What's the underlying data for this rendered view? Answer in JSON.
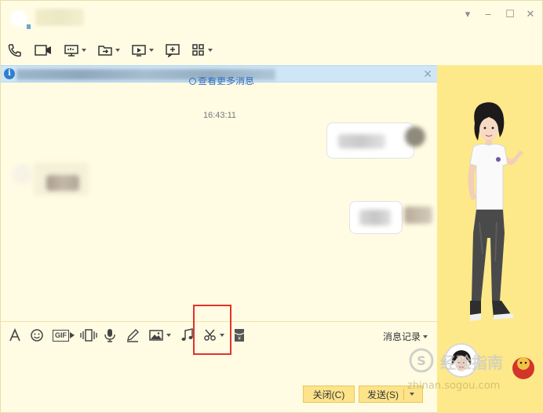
{
  "window": {
    "controls": {
      "minimize": "–",
      "maximize": "☐",
      "close": "✕",
      "dropdown": "▾"
    }
  },
  "toolbar": {
    "items": [
      {
        "name": "voice-call",
        "icon": "phone-icon"
      },
      {
        "name": "video-call",
        "icon": "video-camera-icon"
      },
      {
        "name": "screen-share",
        "icon": "monitor-share-icon",
        "has_dropdown": true
      },
      {
        "name": "send-file",
        "icon": "folder-send-icon",
        "has_dropdown": true
      },
      {
        "name": "remote-desktop",
        "icon": "remote-desktop-icon",
        "has_dropdown": true
      },
      {
        "name": "create-group",
        "icon": "add-chat-icon"
      },
      {
        "name": "apps",
        "icon": "grid-apps-icon",
        "has_dropdown": true
      }
    ]
  },
  "banner": {
    "info_icon": "i",
    "close": "✕",
    "more_messages": "查看更多消息"
  },
  "chat": {
    "timestamp": "16:43:11"
  },
  "input_toolbar": {
    "items": [
      {
        "name": "font",
        "icon": "font-icon"
      },
      {
        "name": "emoji",
        "icon": "smiley-icon"
      },
      {
        "name": "gif",
        "icon": "gif-icon",
        "label": "GIF"
      },
      {
        "name": "shake",
        "icon": "shake-icon"
      },
      {
        "name": "voice-message",
        "icon": "microphone-icon"
      },
      {
        "name": "handwriting",
        "icon": "pencil-icon"
      },
      {
        "name": "image",
        "icon": "image-icon",
        "has_dropdown": true
      },
      {
        "name": "music",
        "icon": "music-note-icon"
      },
      {
        "name": "screenshot",
        "icon": "scissors-icon",
        "has_dropdown": true
      },
      {
        "name": "red-packet",
        "icon": "red-packet-icon"
      }
    ],
    "history_label": "消息记录"
  },
  "buttons": {
    "close_label": "关闭(C)",
    "send_label": "发送(S)"
  },
  "watermark": {
    "brand": "经验指南",
    "url": "zhinan.sogou.com"
  },
  "colors": {
    "background": "#fffce3",
    "banner": "#cfe6f7",
    "side_panel": "#fde98a",
    "button": "#fde48a",
    "highlight": "#e0332b",
    "link": "#2f6fbf"
  }
}
